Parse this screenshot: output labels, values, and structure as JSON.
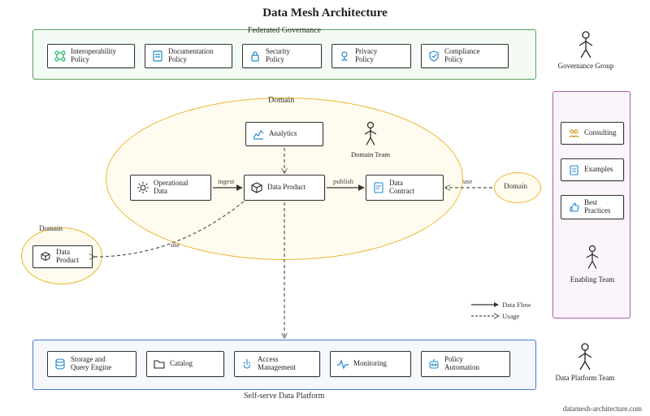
{
  "title": "Data Mesh Architecture",
  "governance": {
    "label": "Federated Governance",
    "team": "Governance Group",
    "items": [
      {
        "name": "interoperability-policy",
        "label": "Interoperability\nPolicy"
      },
      {
        "name": "documentation-policy",
        "label": "Documentation\nPolicy"
      },
      {
        "name": "security-policy",
        "label": "Security\nPolicy"
      },
      {
        "name": "privacy-policy",
        "label": "Privacy\nPolicy"
      },
      {
        "name": "compliance-policy",
        "label": "Compliance\nPolicy"
      }
    ]
  },
  "domain": {
    "label": "Domain",
    "team": "Domain Team",
    "nodes": {
      "operational": "Operational\nData",
      "product": "Data Product",
      "analytics": "Analytics",
      "contract": "Data\nContract"
    },
    "edges": {
      "ingest": "ingest",
      "publish": "publish",
      "use": "use"
    }
  },
  "external_domain": {
    "label": "Domain",
    "product": "Data\nProduct",
    "use": "use"
  },
  "consumer_domain": {
    "label": "Domain"
  },
  "enabling": {
    "team": "Enabling Team",
    "items": [
      {
        "name": "consulting",
        "label": "Consulting"
      },
      {
        "name": "examples",
        "label": "Examples"
      },
      {
        "name": "best-practices",
        "label": "Best\nPractices"
      }
    ]
  },
  "platform": {
    "label": "Self-serve Data Platform",
    "team": "Data Platform Team",
    "items": [
      {
        "name": "storage-query",
        "label": "Storage and\nQuery Engine"
      },
      {
        "name": "catalog",
        "label": "Catalog"
      },
      {
        "name": "access-mgmt",
        "label": "Access\nManagement"
      },
      {
        "name": "monitoring",
        "label": "Monitoring"
      },
      {
        "name": "policy-automation",
        "label": "Policy\nAutomation"
      }
    ]
  },
  "legend": {
    "flow": "Data Flow",
    "usage": "Usage"
  },
  "footer": "datamesh-architecture.com",
  "chart_data": {
    "type": "diagram",
    "title": "Data Mesh Architecture",
    "regions": [
      {
        "id": "federated-governance",
        "label": "Federated Governance",
        "actor": "Governance Group",
        "nodes": [
          "Interoperability Policy",
          "Documentation Policy",
          "Security Policy",
          "Privacy Policy",
          "Compliance Policy"
        ]
      },
      {
        "id": "domain",
        "label": "Domain",
        "actor": "Domain Team",
        "nodes": [
          "Operational Data",
          "Data Product",
          "Analytics",
          "Data Contract"
        ]
      },
      {
        "id": "external-domain",
        "label": "Domain",
        "nodes": [
          "Data Product"
        ]
      },
      {
        "id": "consumer-domain",
        "label": "Domain",
        "nodes": []
      },
      {
        "id": "enabling",
        "actor": "Enabling Team",
        "nodes": [
          "Consulting",
          "Examples",
          "Best Practices"
        ]
      },
      {
        "id": "self-serve-platform",
        "label": "Self-serve Data Platform",
        "actor": "Data Platform Team",
        "nodes": [
          "Storage and Query Engine",
          "Catalog",
          "Access Management",
          "Monitoring",
          "Policy Automation"
        ]
      }
    ],
    "edges": [
      {
        "from": "Operational Data",
        "to": "Data Product",
        "label": "ingest",
        "style": "solid"
      },
      {
        "from": "Data Product",
        "to": "Data Contract",
        "label": "publish",
        "style": "solid"
      },
      {
        "from": "Analytics",
        "to": "Data Product",
        "style": "dashed"
      },
      {
        "from": "Data Contract",
        "to": "consumer Domain",
        "label": "use",
        "style": "dashed"
      },
      {
        "from": "external Data Product",
        "to": "Data Product",
        "label": "use",
        "style": "dashed"
      },
      {
        "from": "Data Product",
        "to": "Self-serve Data Platform",
        "style": "dashed"
      }
    ],
    "legend": [
      {
        "label": "Data Flow",
        "style": "solid"
      },
      {
        "label": "Usage",
        "style": "dashed"
      }
    ]
  }
}
